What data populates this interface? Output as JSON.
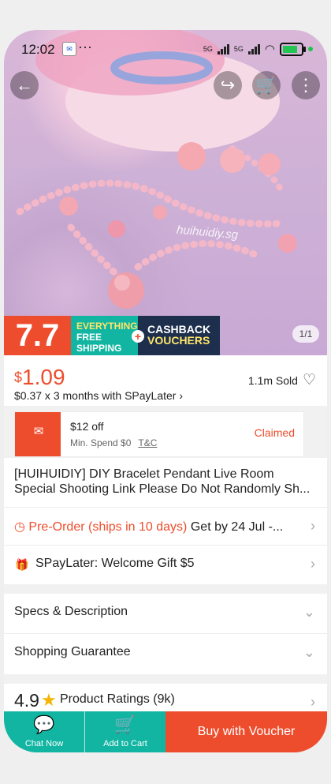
{
  "status_bar": {
    "time": "12:02",
    "mini_icon": "Mail",
    "dots": "···",
    "signal_labels": [
      "5G",
      "5G"
    ],
    "battery_color": "#23c552"
  },
  "hero": {
    "watermark": "huihuidiy.sg",
    "counter": "1/1"
  },
  "banner": {
    "sale": "7.7",
    "shipping_line1": "EVERYTHING",
    "shipping_line2": "FREE",
    "shipping_line3": "SHIPPING",
    "cashback_line1": "CASHBACK",
    "cashback_line2": "VOUCHERS"
  },
  "price": {
    "currency": "$",
    "amount": "1.09",
    "installment": "$0.37 x 3 months with SPayLater ›",
    "sold": "1.1m Sold"
  },
  "voucher": {
    "title": "$12 off",
    "min_spend": "Min. Spend $0",
    "tc": "T&C",
    "status": "Claimed"
  },
  "product": {
    "title": "[HUIHUIDIY] DIY  Bracelet Pendant Live Room Special Shooting Link Please Do Not Randomly Sh..."
  },
  "preorder": {
    "label": "Pre-Order (ships in 10 days)",
    "delivery": "Get by 24 Jul -..."
  },
  "spaylater": {
    "label": "SPayLater: Welcome Gift $5"
  },
  "sections": {
    "specs": "Specs & Description",
    "guarantee": "Shopping Guarantee"
  },
  "rating": {
    "score": "4.9",
    "label": "Product Ratings (9k)"
  },
  "bottom_bar": {
    "chat": "Chat Now",
    "cart": "Add to Cart",
    "buy": "Buy with Voucher"
  },
  "colors": {
    "brand": "#ee4d2d",
    "teal": "#12b5a2",
    "navy": "#1d2f4d"
  }
}
